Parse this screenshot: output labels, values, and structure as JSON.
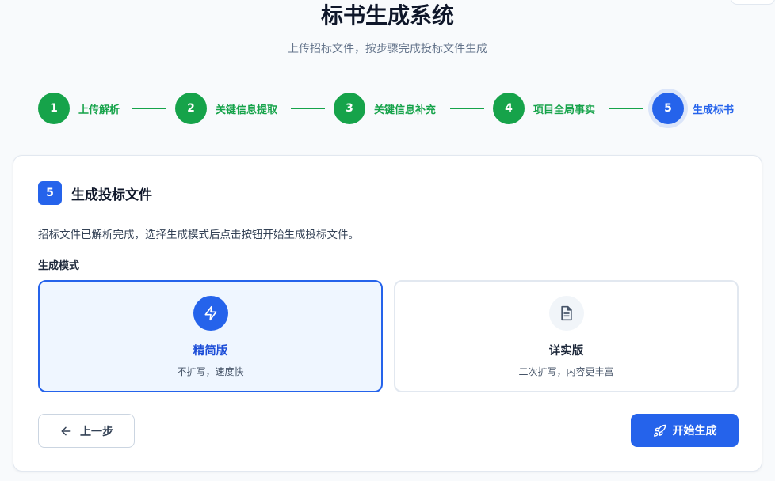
{
  "header": {
    "title": "标书生成系统",
    "subtitle": "上传招标文件，按步骤完成投标文件生成"
  },
  "steps": [
    {
      "number": "1",
      "label": "上传解析",
      "status": "completed"
    },
    {
      "number": "2",
      "label": "关键信息提取",
      "status": "completed"
    },
    {
      "number": "3",
      "label": "关键信息补充",
      "status": "completed"
    },
    {
      "number": "4",
      "label": "项目全局事实",
      "status": "completed"
    },
    {
      "number": "5",
      "label": "生成标书",
      "status": "active"
    }
  ],
  "card": {
    "badge": "5",
    "title": "生成投标文件",
    "description": "招标文件已解析完成，选择生成模式后点击按钮开始生成投标文件。",
    "mode_label": "生成模式",
    "modes": [
      {
        "title": "精简版",
        "description": "不扩写，速度快",
        "icon": "lightning-icon",
        "selected": true
      },
      {
        "title": "详实版",
        "description": "二次扩写，内容更丰富",
        "icon": "document-icon",
        "selected": false
      }
    ]
  },
  "actions": {
    "back_label": "上一步",
    "back_icon": "arrow-left-icon",
    "start_label": "开始生成",
    "start_icon": "rocket-icon"
  },
  "colors": {
    "primary": "#2563eb",
    "success": "#16a34a",
    "selected_bg": "#eff6ff"
  }
}
